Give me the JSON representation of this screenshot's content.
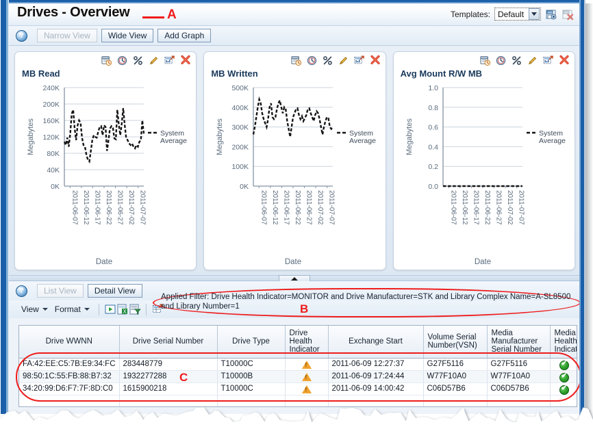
{
  "window": {
    "title": "Drives - Overview"
  },
  "callouts": {
    "a": "A",
    "b": "B",
    "c": "C"
  },
  "templates": {
    "label": "Templates:",
    "selected": "Default",
    "save_icon": "save-template-icon",
    "delete_icon": "delete-template-icon"
  },
  "viewbar": {
    "help_icon": "help-icon",
    "narrow_view": "Narrow View",
    "wide_view": "Wide View",
    "add_graph": "Add Graph"
  },
  "chart_tools": [
    {
      "name": "calendar-range-icon",
      "title": "Date Range"
    },
    {
      "name": "clock-icon",
      "title": "Time Range"
    },
    {
      "name": "percent-icon",
      "title": "Percent"
    },
    {
      "name": "pencil-edit-icon",
      "title": "Edit"
    },
    {
      "name": "chart-expand-icon",
      "title": "Expand"
    },
    {
      "name": "close-x-icon",
      "title": "Remove"
    }
  ],
  "charts": [
    {
      "chart_data": {
        "type": "line",
        "title": "MB Read",
        "xlabel": "Date",
        "ylabel": "Megabytes",
        "legend": [
          "System Average"
        ],
        "legend_position": "right",
        "grid": true,
        "ylim": [
          0,
          240000
        ],
        "yticks": [
          "0K",
          "40K",
          "80K",
          "120K",
          "160K",
          "200K",
          "240K"
        ],
        "ytick_values": [
          0,
          40000,
          80000,
          120000,
          160000,
          200000,
          240000
        ],
        "xticks": [
          "2011-06-07",
          "2011-06-12",
          "2011-06-17",
          "2011-06-22",
          "2011-06-27",
          "2011-07-02",
          "2011-07-07"
        ],
        "series": [
          {
            "name": "System Average",
            "style": "dashed",
            "values": [
              108000,
              100000,
              118000,
              96000,
              128000,
              176000,
              186000,
              140000,
              112000,
              148000,
              160000,
              154000,
              118000,
              100000,
              96000,
              76000,
              64000,
              60000,
              86000,
              112000,
              124000,
              120000,
              118000,
              132000,
              144000,
              146000,
              124000,
              148000,
              144000,
              86000,
              112000,
              140000,
              146000,
              142000,
              116000,
              114000,
              186000,
              150000,
              124000,
              152000,
              190000,
              150000,
              118000,
              112000,
              104000,
              100000,
              104000,
              96000,
              92000,
              100000,
              96000,
              108000,
              112000,
              160000,
              128000
            ]
          }
        ]
      }
    },
    {
      "chart_data": {
        "type": "line",
        "title": "MB Written",
        "xlabel": "Date",
        "ylabel": "Megabytes",
        "legend": [
          "System Average"
        ],
        "legend_position": "right",
        "grid": true,
        "ylim": [
          0,
          500000
        ],
        "yticks": [
          "0K",
          "100K",
          "200K",
          "300K",
          "400K",
          "500K"
        ],
        "ytick_values": [
          0,
          100000,
          200000,
          300000,
          400000,
          500000
        ],
        "xticks": [
          "2011-06-07",
          "2011-06-12",
          "2011-06-17",
          "2011-06-22",
          "2011-06-27",
          "2011-07-02",
          "2011-07-07"
        ],
        "series": [
          {
            "name": "System Average",
            "style": "dashed",
            "values": [
              262000,
              300000,
              350000,
              400000,
              440000,
              420000,
              370000,
              340000,
              320000,
              300000,
              340000,
              400000,
              420000,
              350000,
              340000,
              350000,
              390000,
              420000,
              435000,
              400000,
              370000,
              400000,
              390000,
              330000,
              290000,
              250000,
              300000,
              350000,
              370000,
              390000,
              395000,
              360000,
              340000,
              355000,
              330000,
              345000,
              360000,
              390000,
              395000,
              370000,
              350000,
              330000,
              360000,
              380000,
              370000,
              340000,
              300000,
              262000,
              300000,
              330000,
              350000,
              345000,
              300000,
              290000,
              300000
            ]
          }
        ]
      }
    },
    {
      "chart_data": {
        "type": "line",
        "title": "Avg Mount R/W MB",
        "xlabel": "Date",
        "ylabel": "Megabytes",
        "legend": [
          "System Average"
        ],
        "legend_position": "right",
        "grid": true,
        "ylim": [
          0,
          1.0
        ],
        "yticks": [
          "0.0",
          "0.2",
          "0.4",
          "0.6",
          "0.8",
          "1.0"
        ],
        "ytick_values": [
          0,
          0.2,
          0.4,
          0.6,
          0.8,
          1.0
        ],
        "xticks": [
          "2011-06-07",
          "2011-06-12",
          "2011-06-17",
          "2011-06-22",
          "2011-06-27",
          "2011-07-02",
          "2011-07-07"
        ],
        "series": [
          {
            "name": "System Average",
            "style": "dashed",
            "values": [
              0,
              0,
              0,
              0,
              0,
              0,
              0,
              0,
              0,
              0,
              0,
              0,
              0,
              0,
              0,
              0,
              0,
              0,
              0,
              0,
              0,
              0,
              0,
              0,
              0,
              0,
              0,
              0,
              0,
              0,
              0,
              0,
              0,
              0,
              0,
              0,
              0,
              0,
              0,
              0,
              0,
              0,
              0,
              0,
              0,
              0,
              0,
              0,
              0,
              0,
              0,
              0,
              0,
              0,
              0
            ]
          }
        ]
      }
    }
  ],
  "bottom": {
    "help_icon": "help-icon",
    "list_view": "List View",
    "detail_view": "Detail View",
    "applied_filter": "Applied Filter: Drive Health Indicator=MONITOR and Drive Manufacturer=STK and Library Complex Name=A-SL8500 and Library Number=1",
    "toolbar": {
      "view_menu": "View",
      "format_menu": "Format",
      "icons": [
        {
          "name": "detach-run-icon"
        },
        {
          "name": "export-excel-icon"
        },
        {
          "name": "query-filter-icon"
        },
        {
          "name": "detach-table-icon"
        }
      ]
    },
    "table": {
      "columns": [
        "Drive WWNN",
        "Drive Serial Number",
        "Drive Type",
        "Drive Health Indicator",
        "Exchange Start",
        "Volume Serial Number(VSN)",
        "Media Manufacturer Serial Number",
        "Media Health Indicator"
      ],
      "rows": [
        {
          "wwnn": "FA:42:EE:C5:7B:E9:34:FC",
          "serial": "283448779",
          "type": "T10000C",
          "drive_health": "warning-icon",
          "exchange_start": "2011-06-09 12:27:37",
          "vsn": "G27F5116",
          "media_serial": "G27F5116",
          "media_health": "ok-icon"
        },
        {
          "wwnn": "98:50:1C:55:FB:88:B7:32",
          "serial": "1932277288",
          "type": "T10000B",
          "drive_health": "warning-icon",
          "exchange_start": "2011-06-09 17:24:44",
          "vsn": "W77F10A0",
          "media_serial": "W77F10A0",
          "media_health": "ok-icon"
        },
        {
          "wwnn": "34:20:99:D6:F7:7F:8D:C0",
          "serial": "1615900218",
          "type": "T10000C",
          "drive_health": "warning-icon",
          "exchange_start": "2011-06-09 14:00:42",
          "vsn": "C06D57B6",
          "media_serial": "C06D57B6",
          "media_health": "ok-icon"
        }
      ]
    }
  },
  "colors": {
    "callout_red": "#ee1c1c",
    "frame_blue": "#1b5fa8",
    "title_blue": "#1a3a5c",
    "warning_orange": "#f0a22e",
    "ok_green": "#36a832",
    "link_blue": "#1d4f86"
  }
}
